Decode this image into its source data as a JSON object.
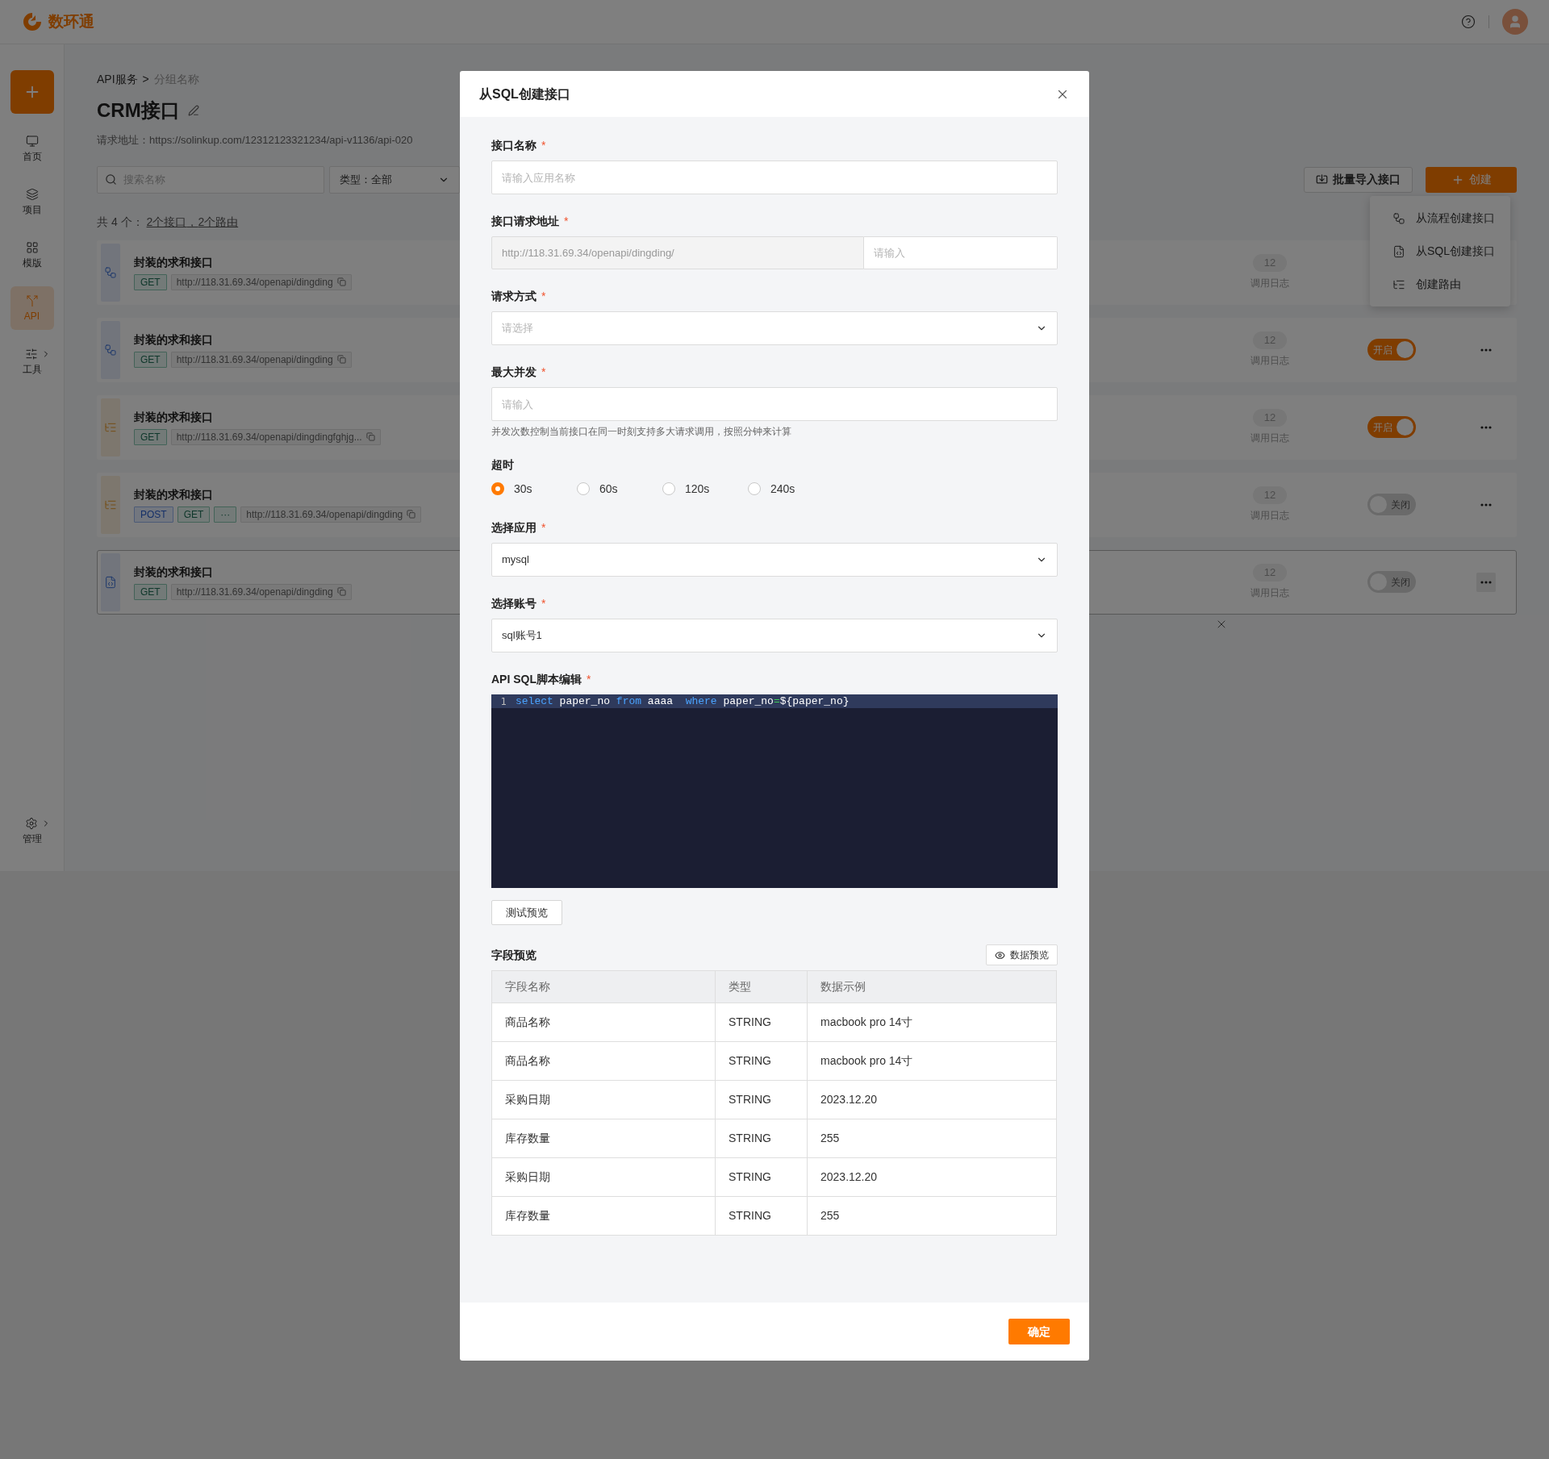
{
  "header": {
    "logo_text": "数环通"
  },
  "sidebar": {
    "items": [
      {
        "label": "首页",
        "kind": "monitor",
        "selected": false,
        "expandable": false
      },
      {
        "label": "项目",
        "kind": "layers",
        "selected": false,
        "expandable": false
      },
      {
        "label": "模版",
        "kind": "grid",
        "selected": false,
        "expandable": false
      },
      {
        "label": "API",
        "kind": "api",
        "selected": true,
        "expandable": false
      },
      {
        "label": "工具",
        "kind": "sliders",
        "selected": false,
        "expandable": true
      }
    ],
    "bottom_item": {
      "label": "管理",
      "kind": "settings",
      "selected": false,
      "expandable": true
    }
  },
  "page": {
    "breadcrumb": {
      "items": [
        "API服务",
        "分组名称"
      ],
      "separator": ">"
    },
    "title": "CRM接口",
    "request_url": "请求地址：https://solinkup.com/12312123321234/api-v1136/api-020",
    "search": {
      "placeholder": "搜索名称"
    },
    "type_filter": "类型：全部",
    "import_button": "批量导入接口",
    "create_button": "创建",
    "summary": {
      "text": "共 4 个：",
      "links": [
        "2个接口",
        "2个路由"
      ],
      "separator": "，"
    }
  },
  "create_menu": [
    {
      "label": "从流程创建接口",
      "kind": "flow"
    },
    {
      "label": "从SQL创建接口",
      "kind": "sql"
    },
    {
      "label": "创建路由",
      "kind": "route"
    }
  ],
  "cards": [
    {
      "kind": "flow",
      "title": "封装的求和接口",
      "tags": [
        {
          "text": "GET",
          "kind": "get"
        }
      ],
      "url": "http://118.31.69.34/openapi/dingding",
      "count": "12",
      "count_label": "调用日志",
      "hovered": false
    },
    {
      "kind": "flow",
      "title": "封装的求和接口",
      "tags": [
        {
          "text": "GET",
          "kind": "get"
        }
      ],
      "url": "http://118.31.69.34/openapi/dingding",
      "count": "12",
      "count_label": "调用日志",
      "toggle": {
        "on": true,
        "label": "开启"
      },
      "more": true,
      "hovered": false
    },
    {
      "kind": "route",
      "title": "封装的求和接口",
      "tags": [
        {
          "text": "GET",
          "kind": "get"
        }
      ],
      "url": "http://118.31.69.34/openapi/dingdingfghjg...",
      "count": "12",
      "count_label": "调用日志",
      "toggle": {
        "on": true,
        "label": "开启"
      },
      "more": true,
      "hovered": false
    },
    {
      "kind": "route",
      "title": "封装的求和接口",
      "tags": [
        {
          "text": "POST",
          "kind": "post"
        },
        {
          "text": "GET",
          "kind": "get"
        },
        {
          "text": "···",
          "kind": "get"
        }
      ],
      "url": "http://118.31.69.34/openapi/dingding",
      "count": "12",
      "count_label": "调用日志",
      "toggle": {
        "on": false,
        "label": "关闭"
      },
      "more": true,
      "hovered": false
    },
    {
      "kind": "sql",
      "title": "封装的求和接口",
      "tags": [
        {
          "text": "GET",
          "kind": "get"
        }
      ],
      "url": "http://118.31.69.34/openapi/dingding",
      "count": "12",
      "count_label": "调用日志",
      "toggle": {
        "on": false,
        "label": "关闭"
      },
      "more": true,
      "hovered": true
    }
  ],
  "dialog": {
    "title": "从SQL创建接口",
    "required_mark": "*",
    "fields": [
      {
        "kind": "text",
        "label": "接口名称",
        "required": true,
        "placeholder": "请输入应用名称"
      },
      {
        "kind": "url",
        "label": "接口请求地址",
        "required": true,
        "prefix": "http://118.31.69.34/openapi/dingding/",
        "placeholder": "请输入"
      },
      {
        "kind": "select",
        "label": "请求方式",
        "required": true,
        "placeholder": "请选择"
      },
      {
        "kind": "text",
        "label": "最大并发",
        "required": true,
        "placeholder": "请输入",
        "help": "并发次数控制当前接口在同一时刻支持多大请求调用，按照分钟来计算"
      },
      {
        "kind": "radio",
        "label": "超时",
        "required": false,
        "options": [
          {
            "label": "30s",
            "selected": true
          },
          {
            "label": "60s",
            "selected": false
          },
          {
            "label": "120s",
            "selected": false
          },
          {
            "label": "240s",
            "selected": false
          }
        ]
      },
      {
        "kind": "select",
        "label": "选择应用",
        "required": true,
        "value": "mysql"
      },
      {
        "kind": "select",
        "label": "选择账号",
        "required": true,
        "value": "sql账号1"
      },
      {
        "kind": "code",
        "label": "API SQL脚本编辑",
        "required": true,
        "lines": [
          {
            "number": "1",
            "tokens": [
              {
                "text": "select",
                "kind": "keyword"
              },
              {
                "text": " paper_no ",
                "kind": "plain"
              },
              {
                "text": "from",
                "kind": "keyword"
              },
              {
                "text": " aaaa  ",
                "kind": "plain"
              },
              {
                "text": "where",
                "kind": "keyword"
              },
              {
                "text": " paper_no",
                "kind": "plain"
              },
              {
                "text": "=",
                "kind": "operator"
              },
              {
                "text": "${paper_no}",
                "kind": "plain"
              }
            ]
          }
        ]
      }
    ],
    "test_button": "测试预览",
    "preview": {
      "title": "字段预览",
      "button": "数据预览",
      "columns": [
        "字段名称",
        "类型",
        "数据示例"
      ],
      "rows": [
        [
          "商品名称",
          "STRING",
          "macbook pro 14寸"
        ],
        [
          "商品名称",
          "STRING",
          "macbook pro 14寸"
        ],
        [
          "采购日期",
          "STRING",
          "2023.12.20"
        ],
        [
          "库存数量",
          "STRING",
          "255"
        ],
        [
          "采购日期",
          "STRING",
          "2023.12.20"
        ],
        [
          "库存数量",
          "STRING",
          "255"
        ]
      ]
    },
    "confirm_button": "确定"
  }
}
